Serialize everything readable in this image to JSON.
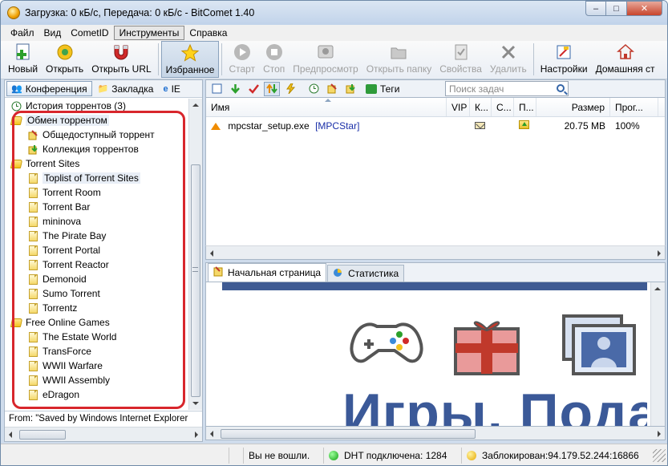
{
  "window": {
    "title": "Загрузка: 0 кБ/с, Передача: 0 кБ/с - BitComet 1.40",
    "minimize": "–",
    "maximize": "□",
    "close": "✕"
  },
  "menu": [
    "Файл",
    "Вид",
    "CometID",
    "Инструменты",
    "Справка"
  ],
  "toolbar": {
    "buttons": [
      {
        "label": "Новый",
        "icon": "new-document-icon",
        "enabled": true
      },
      {
        "label": "Открыть",
        "icon": "open-torrent-icon",
        "enabled": true
      },
      {
        "label": "Открыть URL",
        "icon": "magnet-icon",
        "enabled": true
      },
      {
        "label": "Избранное",
        "icon": "star-icon",
        "enabled": true,
        "pressed": true
      },
      {
        "label": "Старт",
        "icon": "play-icon",
        "enabled": false
      },
      {
        "label": "Стоп",
        "icon": "stop-icon",
        "enabled": false
      },
      {
        "label": "Предпросмотр",
        "icon": "preview-icon",
        "enabled": false
      },
      {
        "label": "Открыть папку",
        "icon": "folder-icon",
        "enabled": false
      },
      {
        "label": "Свойства",
        "icon": "properties-icon",
        "enabled": false
      },
      {
        "label": "Удалить",
        "icon": "delete-icon",
        "enabled": false
      },
      {
        "label": "Настройки",
        "icon": "settings-icon",
        "enabled": true
      },
      {
        "label": "Домашняя ст",
        "icon": "home-icon",
        "enabled": true
      }
    ]
  },
  "left_panel": {
    "tabs": [
      {
        "label": "Конференция",
        "icon": "conference-icon"
      },
      {
        "label": "Закладка",
        "icon": "bookmark-icon"
      },
      {
        "label": "IE",
        "icon": "ie-icon"
      }
    ],
    "tree": [
      {
        "label": "История торрентов (3)",
        "level": 0,
        "icon": "history-icon"
      },
      {
        "label": "Обмен торрентом",
        "level": 0,
        "icon": "folder-icon",
        "selected": true
      },
      {
        "label": "Общедоступный торрент",
        "level": 1,
        "icon": "public-torrent-icon"
      },
      {
        "label": "Коллекция торрентов",
        "level": 1,
        "icon": "collection-icon"
      },
      {
        "label": "Torrent Sites",
        "level": 0,
        "icon": "folder-icon"
      },
      {
        "label": "Toplist of Torrent Sites",
        "level": 1,
        "icon": "page-icon",
        "selected": true
      },
      {
        "label": "Torrent Room",
        "level": 1,
        "icon": "page-icon"
      },
      {
        "label": "Torrent Bar",
        "level": 1,
        "icon": "page-icon"
      },
      {
        "label": "mininova",
        "level": 1,
        "icon": "page-icon"
      },
      {
        "label": "The Pirate Bay",
        "level": 1,
        "icon": "page-icon"
      },
      {
        "label": "Torrent Portal",
        "level": 1,
        "icon": "page-icon"
      },
      {
        "label": "Torrent Reactor",
        "level": 1,
        "icon": "page-icon"
      },
      {
        "label": "Demonoid",
        "level": 1,
        "icon": "page-icon"
      },
      {
        "label": "Sumo Torrent",
        "level": 1,
        "icon": "page-icon"
      },
      {
        "label": "Torrentz",
        "level": 1,
        "icon": "page-icon"
      },
      {
        "label": "Free Online Games",
        "level": 0,
        "icon": "folder-icon"
      },
      {
        "label": "The Estate World",
        "level": 1,
        "icon": "page-icon"
      },
      {
        "label": "TransForce",
        "level": 1,
        "icon": "page-icon"
      },
      {
        "label": "WWII Warfare",
        "level": 1,
        "icon": "page-icon"
      },
      {
        "label": "WWII Assembly",
        "level": 1,
        "icon": "page-icon"
      },
      {
        "label": "eDragon",
        "level": 1,
        "icon": "page-icon"
      }
    ],
    "from_text": "From: \"Saved by Windows Internet Explorer"
  },
  "tasks": {
    "tags_label": "Теги",
    "search_placeholder": "Поиск задач",
    "columns": [
      "Имя",
      "VIP",
      "К...",
      "С...",
      "П...",
      "Размер",
      "Прог..."
    ],
    "rows": [
      {
        "name": "mpcstar_setup.exe",
        "tag": "[MPCStar]",
        "size": "20.75 MB",
        "progress": "100%"
      }
    ]
  },
  "bottom_tabs": [
    {
      "label": "Начальная страница",
      "icon": "home-page-icon"
    },
    {
      "label": "Статистика",
      "icon": "statistics-icon"
    }
  ],
  "web": {
    "headline": "Игры, Пода"
  },
  "status": {
    "login": "Вы не вошли.",
    "dht": "DHT подключена: 1284",
    "blocked": "Заблокирован:94.179.52.244:16866"
  }
}
